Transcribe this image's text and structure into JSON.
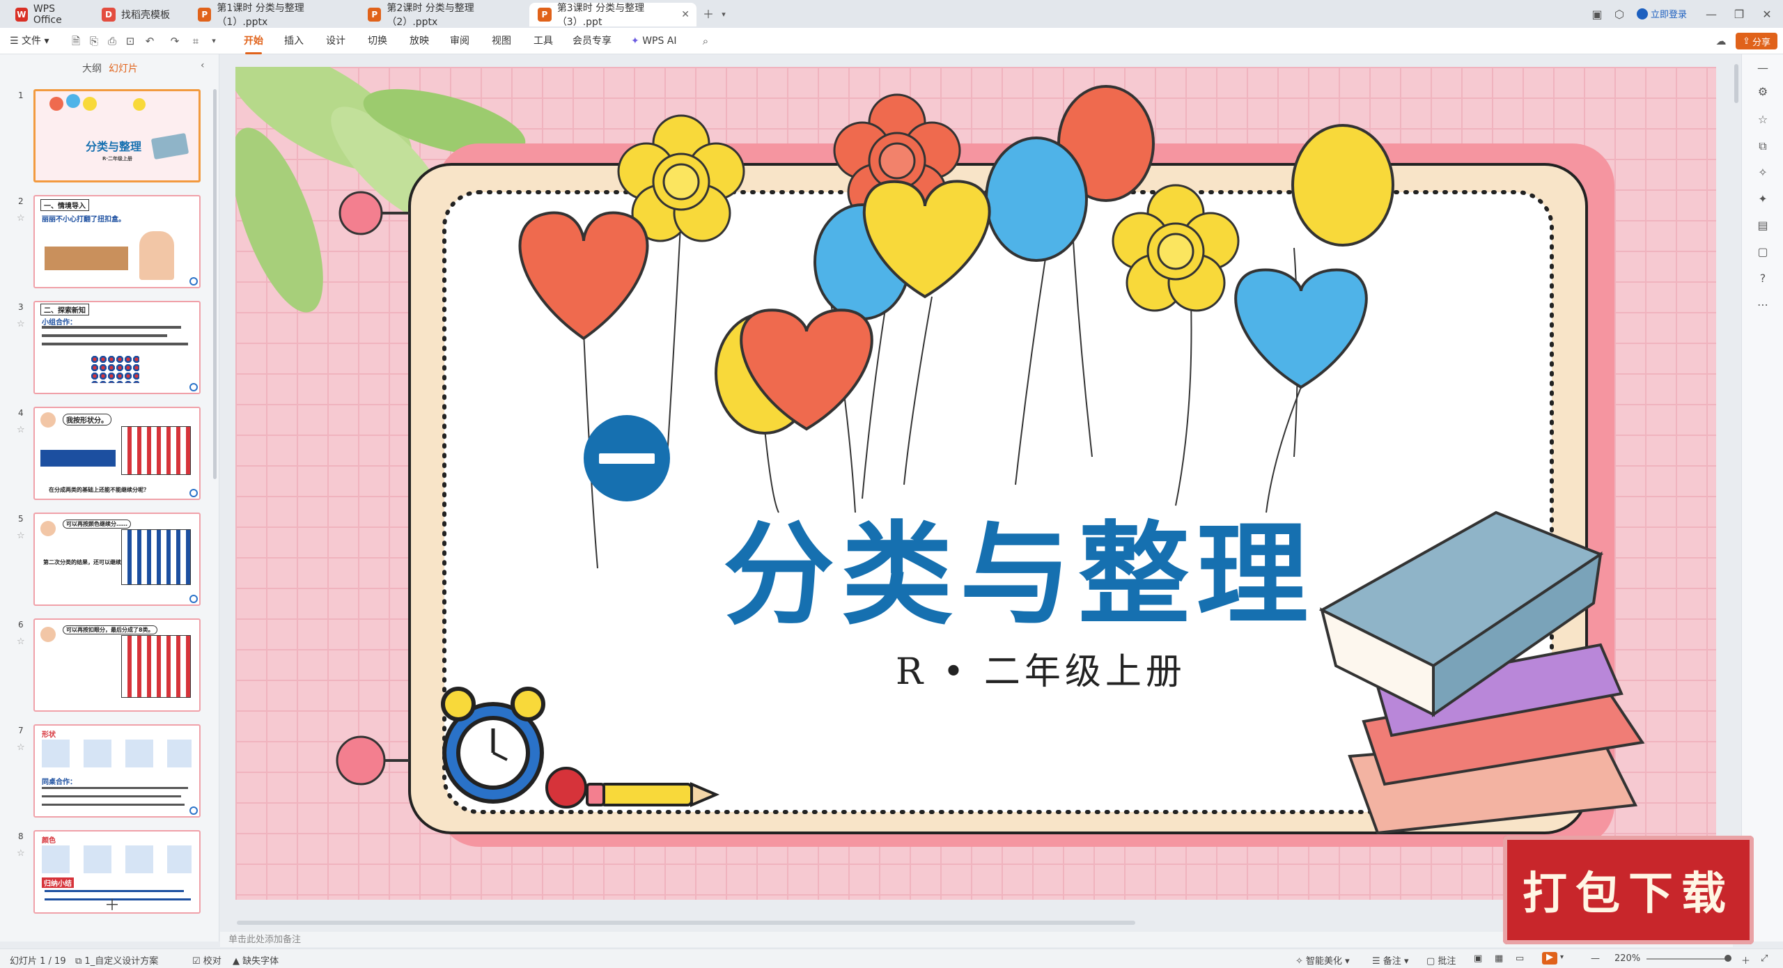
{
  "tabs": [
    {
      "label": "WPS Office",
      "icon": "wps-logo-icon",
      "color": "#d93025"
    },
    {
      "label": "找稻壳模板",
      "icon": "docer-icon",
      "color": "#e34d3f"
    },
    {
      "label": "第1课时 分类与整理（1）.pptx",
      "icon": "ppt-icon",
      "color": "#e0621a"
    },
    {
      "label": "第2课时 分类与整理（2）.pptx",
      "icon": "ppt-icon",
      "color": "#e0621a"
    },
    {
      "label": "第3课时 分类与整理（3）.ppt",
      "icon": "ppt-icon",
      "color": "#e0621a"
    }
  ],
  "titlebar": {
    "login_label": "立即登录",
    "share_label": "分享"
  },
  "menu": {
    "file": "文件",
    "items": [
      "开始",
      "插入",
      "设计",
      "切换",
      "放映",
      "审阅",
      "视图",
      "工具",
      "会员专享",
      "WPS AI"
    ],
    "active": "开始"
  },
  "leftpanel": {
    "tab_outline": "大纲",
    "tab_slides": "幻灯片",
    "slides": [
      {
        "num": "1",
        "caption": "分类与整理",
        "sub": "R·二年级上册"
      },
      {
        "num": "2",
        "caption": "一、情境导入",
        "sub": "丽丽不小心打翻了扭扣盒。"
      },
      {
        "num": "3",
        "caption": "二、探索新知",
        "sub": "小组合作："
      },
      {
        "num": "4",
        "caption": "我按形状分。",
        "sub": "在分成两类的基础上还能不能继续分呢？"
      },
      {
        "num": "5",
        "caption": "可以再按颜色继续分……",
        "sub": "第二次分类的结果，还可以继续分吗？"
      },
      {
        "num": "6",
        "caption": "可以再按扣眼分，最后分成了8类。",
        "sub": ""
      },
      {
        "num": "7",
        "caption": "形状",
        "sub": "同桌合作："
      },
      {
        "num": "8",
        "caption": "颜色",
        "sub": "归纳小结"
      }
    ]
  },
  "slide": {
    "badge": "一",
    "title": "分类与整理",
    "subtitle": "R • 二年级上册"
  },
  "notes_placeholder": "单击此处添加备注",
  "download_badge": "打包下载",
  "statusbar": {
    "slide_count": "幻灯片 1 / 19",
    "theme": "1_自定义设计方案",
    "proofread": "校对",
    "missing_font": "缺失字体",
    "smart_beautify": "智能美化",
    "notes": "备注",
    "comments": "批注",
    "zoom": "220%"
  },
  "colors": {
    "accent": "#e0621a",
    "title_blue": "#1670b0",
    "slide_bg": "#f6c9d1",
    "badge_red": "#c8262b"
  }
}
